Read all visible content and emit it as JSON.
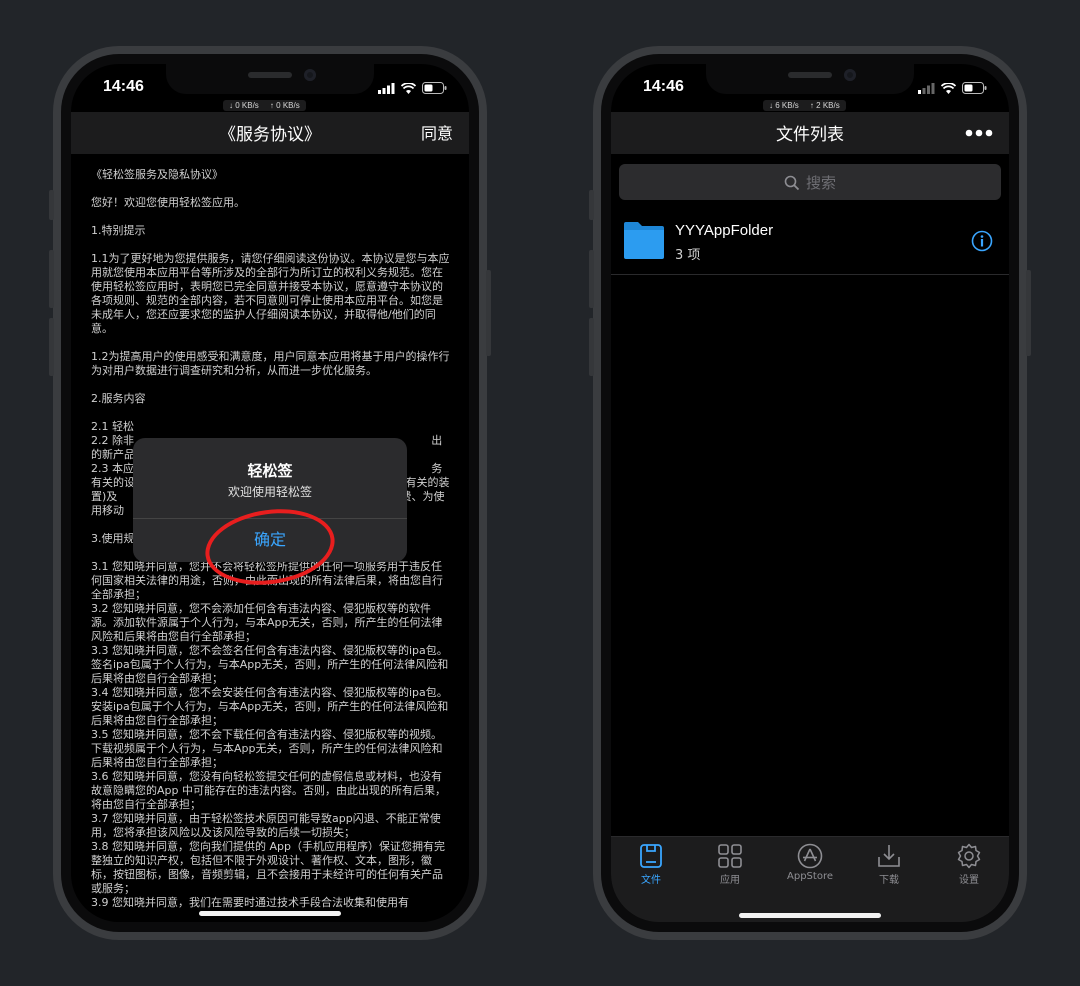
{
  "left_phone": {
    "time": "14:46",
    "net_down": "↓ 0 KB/s",
    "net_up": "↑ 0 KB/s",
    "nav_title": "《服务协议》",
    "nav_right": "同意",
    "doc_text": "《轻松签服务及隐私协议》\n\n您好！欢迎您使用轻松签应用。\n\n1.特别提示\n\n1.1为了更好地为您提供服务，请您仔细阅读这份协议。本协议是您与本应用就您使用本应用平台等所涉及的全部行为所订立的权利义务规范。您在使用轻松签应用时，表明您已完全同意并接受本协议，愿意遵守本协议的各项规则、规范的全部内容，若不同意则可停止使用本应用平台。如您是未成年人，您还应要求您的监护人仔细阅读本协议，并取得他/他们的同意。\n\n1.2为提高用户的使用感受和满意度，用户同意本应用将基于用户的操作行为对用户数据进行调查研究和分析，从而进一步优化服务。\n\n2.服务内容\n\n2.1 轻松\n2.2 除非                                                                                     出的新产品、新\n2.3 本应                                                                                     务有关的设备(                                                                         有关的装置)及                                                                                 费、为使用移动\n\n3.使用规\n\n3.1 您知晓并同意，您并不会将轻松签所提供的任何一项服务用于违反任何国家相关法律的用途，否则，由此而出现的所有法律后果，将由您自行全部承担；\n3.2 您知晓并同意，您不会添加任何含有违法内容、侵犯版权等的软件源。添加软件源属于个人行为，与本App无关，否则，所产生的任何法律风险和后果将由您自行全部承担；\n3.3 您知晓并同意，您不会签名任何含有违法内容、侵犯版权等的ipa包。签名ipa包属于个人行为，与本App无关，否则，所产生的任何法律风险和后果将由您自行全部承担；\n3.4 您知晓并同意，您不会安装任何含有违法内容、侵犯版权等的ipa包。安装ipa包属于个人行为，与本App无关，否则，所产生的任何法律风险和后果将由您自行全部承担；\n3.5 您知晓并同意，您不会下载任何含有违法内容、侵犯版权等的视频。下载视频属于个人行为，与本App无关，否则，所产生的任何法律风险和后果将由您自行全部承担；\n3.6 您知晓并同意，您没有向轻松签提交任何的虚假信息或材料，也没有故意隐瞒您的App 中可能存在的违法内容。否则，由此出现的所有后果，将由您自行全部承担；\n3.7 您知晓并同意，由于轻松签技术原因可能导致app闪退、不能正常使用，您将承担该风险以及该风险导致的后续一切损失；\n3.8 您知晓并同意，您向我们提供的 App（手机应用程序）保证您拥有完整独立的知识产权，包括但不限于外观设计、著作权、文本，图形，徽标，按钮图标，图像，音频剪辑，且不会接用于未经许可的任何有关产品或服务；\n3.9 您知晓并同意，我们在需要时通过技术手段合法收集和使用有",
    "dialog": {
      "title": "轻松签",
      "message": "欢迎使用轻松签",
      "confirm_label": "确定"
    },
    "annotation_color": "#e81e1e"
  },
  "right_phone": {
    "time": "14:46",
    "net_down": "↓ 6 KB/s",
    "net_up": "↑ 2 KB/s",
    "nav_title": "文件列表",
    "more_icon": "more-icon",
    "search_placeholder": "搜索",
    "files": [
      {
        "name": "YYYAppFolder",
        "subtitle": "3 项",
        "icon": "folder-icon"
      }
    ],
    "tabs": [
      {
        "label": "文件",
        "icon": "file-icon",
        "active": true
      },
      {
        "label": "应用",
        "icon": "grid-icon",
        "active": false
      },
      {
        "label": "AppStore",
        "icon": "appstore-icon",
        "active": false
      },
      {
        "label": "下载",
        "icon": "download-icon",
        "active": false
      },
      {
        "label": "设置",
        "icon": "gear-icon",
        "active": false
      }
    ],
    "accent_color": "#3aa6ff"
  }
}
